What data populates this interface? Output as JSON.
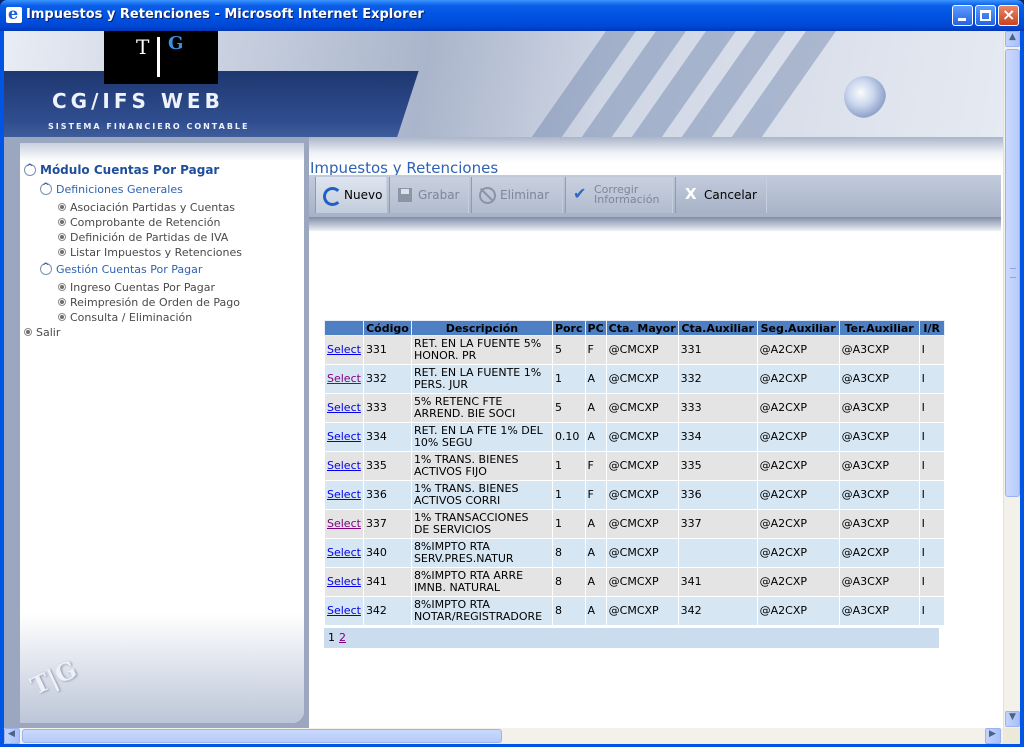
{
  "window": {
    "title": "Impuestos y Retenciones - Microsoft Internet Explorer"
  },
  "header": {
    "logo_left": "T",
    "logo_right": "G",
    "brand": "CG/IFS  WEB",
    "brand_sub": "SISTEMA FINANCIERO CONTABLE"
  },
  "sidebar": {
    "module": "Módulo Cuentas Por Pagar",
    "groups": [
      {
        "label": "Definiciones Generales",
        "items": [
          "Asociación Partidas y Cuentas",
          "Comprobante de Retención",
          "Definición de Partidas de IVA",
          "Listar Impuestos y Retenciones"
        ]
      },
      {
        "label": "Gestión Cuentas Por Pagar",
        "items": [
          "Ingreso Cuentas Por Pagar",
          "Reimpresión de Orden de Pago",
          "Consulta / Eliminación"
        ]
      }
    ],
    "exit": "Salir"
  },
  "page": {
    "title": "Impuestos y Retenciones"
  },
  "toolbar": {
    "new": "Nuevo",
    "save": "Grabar",
    "delete": "Eliminar",
    "fix_line1": "Corregir",
    "fix_line2": "Información",
    "cancel": "Cancelar"
  },
  "grid": {
    "headers": [
      "",
      "Código",
      "Descripción",
      "Porc",
      "PC",
      "Cta. Mayor",
      "Cta.Auxiliar",
      "Seg.Auxiliar",
      "Ter.Auxiliar",
      "I/R"
    ],
    "select_label": "Select",
    "rows": [
      {
        "codigo": "331",
        "desc1": "RET. EN LA FUENTE 5%",
        "desc2": "HONOR. PR",
        "porc": "5",
        "pc": "F",
        "mayor": "@CMCXP",
        "aux": "331",
        "seg": "@A2CXP",
        "ter": "@A3CXP",
        "ir": "I"
      },
      {
        "codigo": "332",
        "desc1": "RET. EN LA FUENTE 1%",
        "desc2": "PERS. JUR",
        "porc": "1",
        "pc": "A",
        "mayor": "@CMCXP",
        "aux": "332",
        "seg": "@A2CXP",
        "ter": "@A3CXP",
        "ir": "I"
      },
      {
        "codigo": "333",
        "desc1": "5% RETENC FTE",
        "desc2": "ARREND. BIE SOCI",
        "porc": "5",
        "pc": "A",
        "mayor": "@CMCXP",
        "aux": "333",
        "seg": "@A2CXP",
        "ter": "@A3CXP",
        "ir": "I"
      },
      {
        "codigo": "334",
        "desc1": "RET. EN LA FTE 1% DEL",
        "desc2": "10% SEGU",
        "porc": "0.10",
        "pc": "A",
        "mayor": "@CMCXP",
        "aux": "334",
        "seg": "@A2CXP",
        "ter": "@A3CXP",
        "ir": "I"
      },
      {
        "codigo": "335",
        "desc1": "1% TRANS. BIENES",
        "desc2": "ACTIVOS FIJO",
        "porc": "1",
        "pc": "F",
        "mayor": "@CMCXP",
        "aux": "335",
        "seg": "@A2CXP",
        "ter": "@A3CXP",
        "ir": "I"
      },
      {
        "codigo": "336",
        "desc1": "1% TRANS. BIENES",
        "desc2": "ACTIVOS CORRI",
        "porc": "1",
        "pc": "F",
        "mayor": "@CMCXP",
        "aux": "336",
        "seg": "@A2CXP",
        "ter": "@A3CXP",
        "ir": "I"
      },
      {
        "codigo": "337",
        "desc1": "1% TRANSACCIONES",
        "desc2": "DE SERVICIOS",
        "porc": "1",
        "pc": "A",
        "mayor": "@CMCXP",
        "aux": "337",
        "seg": "@A2CXP",
        "ter": "@A3CXP",
        "ir": "I"
      },
      {
        "codigo": "340",
        "desc1": "8%IMPTO RTA",
        "desc2": "SERV.PRES.NATUR",
        "porc": "8",
        "pc": "A",
        "mayor": "@CMCXP",
        "aux": "",
        "seg": "@A2CXP",
        "ter": "@A2CXP",
        "ir": "I"
      },
      {
        "codigo": "341",
        "desc1": "8%IMPTO RTA ARRE",
        "desc2": "IMNB. NATURAL",
        "porc": "8",
        "pc": "A",
        "mayor": "@CMCXP",
        "aux": "341",
        "seg": "@A2CXP",
        "ter": "@A3CXP",
        "ir": "I"
      },
      {
        "codigo": "342",
        "desc1": "8%IMPTO RTA",
        "desc2": "NOTAR/REGISTRADORE",
        "porc": "8",
        "pc": "A",
        "mayor": "@CMCXP",
        "aux": "342",
        "seg": "@A2CXP",
        "ter": "@A3CXP",
        "ir": "I"
      }
    ]
  },
  "pager": {
    "current": "1",
    "next": "2"
  },
  "colors": {
    "accent": "#2e62b4",
    "grid_header": "#4d7fc2",
    "row_odd": "#e4e4e4",
    "row_even": "#d6e6f3"
  }
}
